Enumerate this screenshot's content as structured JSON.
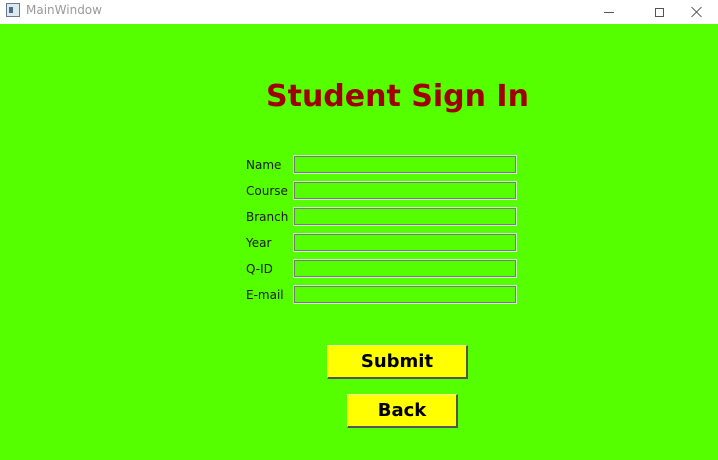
{
  "window": {
    "title": "MainWindow"
  },
  "form": {
    "heading": "Student Sign In",
    "fields": [
      {
        "label": "Name",
        "value": ""
      },
      {
        "label": "Course",
        "value": ""
      },
      {
        "label": "Branch",
        "value": ""
      },
      {
        "label": "Year",
        "value": ""
      },
      {
        "label": "Q-ID",
        "value": ""
      },
      {
        "label": "E-mail",
        "value": ""
      }
    ],
    "submit_label": "Submit",
    "back_label": "Back"
  },
  "colors": {
    "background": "#55ff00",
    "heading": "#a00000",
    "button": "#ffff00"
  },
  "icons": {
    "app": "app-window-icon",
    "minimize": "minimize-icon",
    "maximize": "maximize-icon",
    "close": "close-icon"
  }
}
